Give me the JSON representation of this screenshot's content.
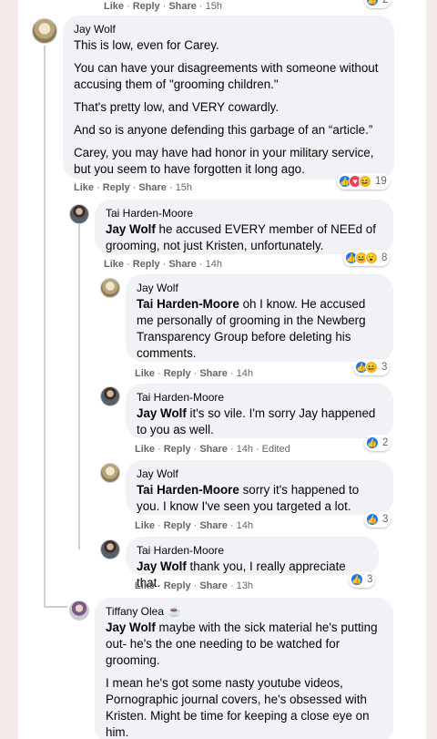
{
  "top_actions": {
    "like": "Like",
    "reply": "Reply",
    "share": "Share",
    "time": "15h",
    "count": "2"
  },
  "comments": [
    {
      "author": "Jay Wolf",
      "paragraphs": [
        "This is low, even for Carey.",
        "You can have your disagreements with someone without accusing them of \"grooming children.\"",
        "That's pretty low, and VERY cowardly.",
        "And so is anyone defending this garbage of an “article.”",
        "Carey, you may have had honor in your military service, but you seem to have forgotten it long ago."
      ],
      "like": "Like",
      "reply": "Reply",
      "share": "Share",
      "time": "15h",
      "reaction_icons": [
        "like-icon",
        "love-icon",
        "haha-icon"
      ],
      "reaction_count": "19"
    },
    {
      "author": "Tai Harden-Moore",
      "mention": "Jay Wolf",
      "text": " he accused EVERY member of NEEd of grooming, not just Kristen, unfortunately.",
      "like": "Like",
      "reply": "Reply",
      "share": "Share",
      "time": "14h",
      "reaction_icons": [
        "like-icon",
        "haha-icon",
        "wow-icon"
      ],
      "reaction_count": "8"
    },
    {
      "author": "Jay Wolf",
      "mention": "Tai Harden-Moore",
      "text": " oh I know. He accused me personally of grooming in the Newberg Transparency Group before deleting his comments.",
      "like": "Like",
      "reply": "Reply",
      "share": "Share",
      "time": "14h",
      "reaction_icons": [
        "like-icon",
        "haha-icon"
      ],
      "reaction_count": "3"
    },
    {
      "author": "Tai Harden-Moore",
      "mention": "Jay Wolf",
      "text": " it's so vile. I'm sorry Jay happened to you as well.",
      "like": "Like",
      "reply": "Reply",
      "share": "Share",
      "time": "14h",
      "edited": "Edited",
      "reaction_icons": [
        "like-icon"
      ],
      "reaction_count": "2"
    },
    {
      "author": "Jay Wolf",
      "mention": "Tai Harden-Moore",
      "text": " sorry it's happened to you. I know I've seen you targeted a lot.",
      "like": "Like",
      "reply": "Reply",
      "share": "Share",
      "time": "14h",
      "reaction_icons": [
        "like-icon"
      ],
      "reaction_count": "3"
    },
    {
      "author": "Tai Harden-Moore",
      "mention": "Jay Wolf",
      "text": " thank you, I really appreciate that.",
      "like": "Like",
      "reply": "Reply",
      "share": "Share",
      "time": "13h",
      "reaction_icons": [
        "like-icon"
      ],
      "reaction_count": "3"
    },
    {
      "author": "Tiffany Olea",
      "author_badge": "☕",
      "mention": "Jay Wolf",
      "text": " maybe with the sick material he's putting out- he's the one needing to be watched for grooming.",
      "paragraph2": "I mean he's got some nasty youtube videos, Pornographic journal covers, he's obsessed with Kristen. Might be time for keeping a close eye on him."
    }
  ]
}
